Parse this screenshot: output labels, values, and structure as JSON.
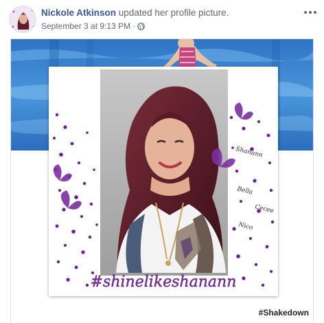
{
  "post": {
    "author": "Nickole Atkinson",
    "action": "updated her profile picture.",
    "timestamp": "September 3 at 9:13 PM",
    "separator": "·",
    "privacy_icon": "globe-icon",
    "more_icon": "more-options-icon"
  },
  "profile_picture": {
    "side_names": [
      "Shanann",
      "Bella",
      "Cecee",
      "Nico"
    ],
    "caption": "#shinelikeshanann"
  },
  "hashtag": "#Shakedown",
  "colors": {
    "link": "#385898",
    "meta": "#606770",
    "cover_blue": "#3f86d4",
    "star_purple": "#6a1b9a"
  }
}
